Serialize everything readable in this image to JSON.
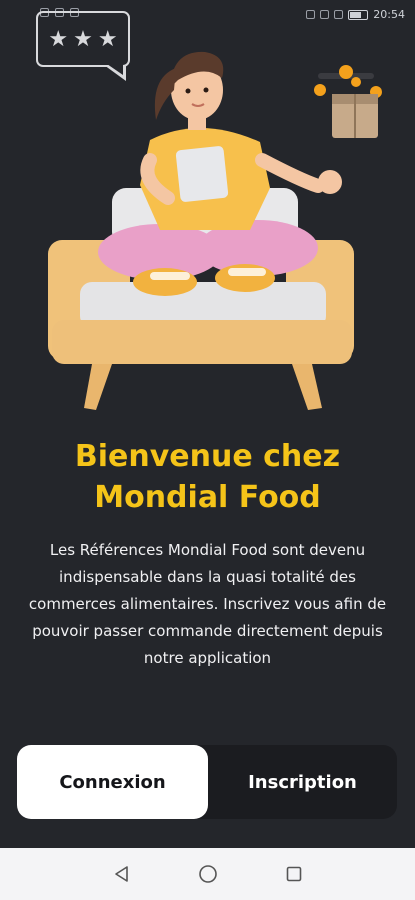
{
  "status_bar": {
    "time": "20:54",
    "battery_level": 0.6
  },
  "rating": {
    "stars": 3,
    "star_glyph": "★"
  },
  "colors": {
    "background": "#24262b",
    "accent": "#f5c419",
    "switch_bg": "#1b1c20",
    "active_btn_bg": "#ffffff"
  },
  "welcome": {
    "title_line1": "Bienvenue chez",
    "title_line2": "Mondial Food",
    "description": "Les Références Mondial Food sont devenu indispensable dans la quasi totalité des commerces alimentaires. Inscrivez vous afin de pouvoir passer commande directement depuis notre application"
  },
  "auth": {
    "login_label": "Connexion",
    "signup_label": "Inscription",
    "selected": "Connexion"
  },
  "nav": {
    "icons": [
      "back-icon",
      "home-icon",
      "recents-icon"
    ]
  }
}
